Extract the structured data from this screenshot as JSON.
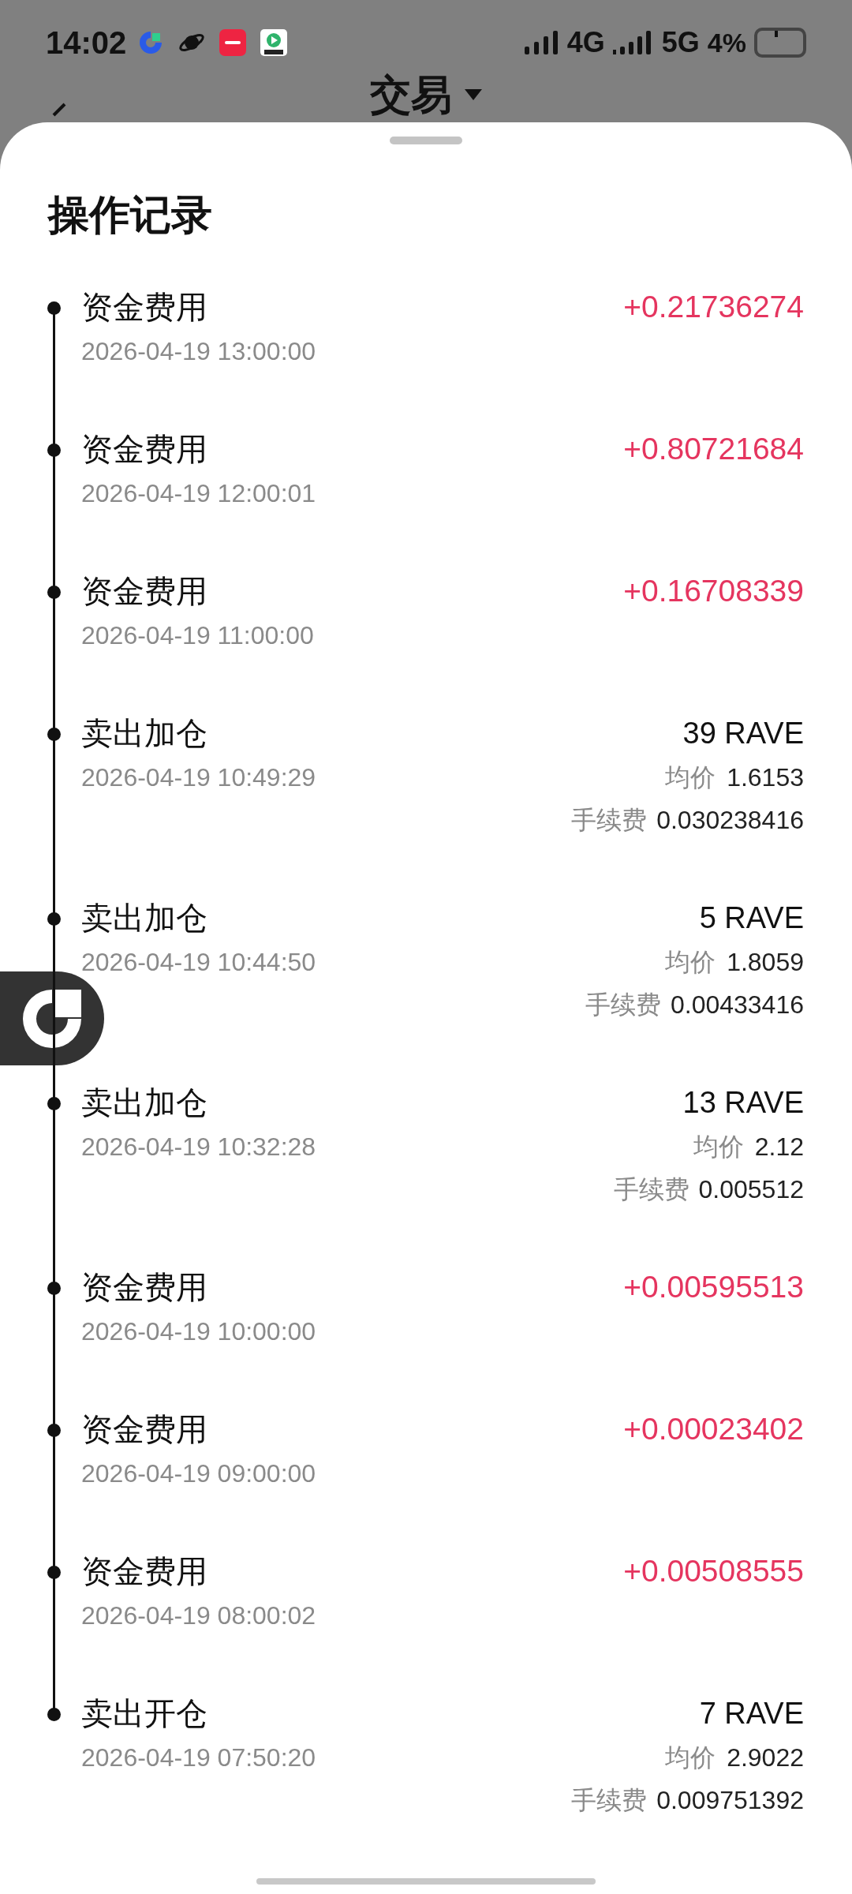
{
  "status_bar": {
    "time": "14:02",
    "network_1": "4G",
    "network_2": "5G",
    "battery": "4%"
  },
  "header": {
    "title": "交易"
  },
  "sheet": {
    "title": "操作记录"
  },
  "records": [
    {
      "kind": "funding",
      "title": "资金费用",
      "time": "2026-04-19 13:00:00",
      "amount": "+0.21736274"
    },
    {
      "kind": "funding",
      "title": "资金费用",
      "time": "2026-04-19 12:00:01",
      "amount": "+0.80721684"
    },
    {
      "kind": "funding",
      "title": "资金费用",
      "time": "2026-04-19 11:00:00",
      "amount": "+0.16708339"
    },
    {
      "kind": "trade",
      "title": "卖出加仓",
      "time": "2026-04-19 10:49:29",
      "quantity": "39 RAVE",
      "avg_price_label": "均价",
      "avg_price": "1.6153",
      "fee_label": "手续费",
      "fee": "0.030238416"
    },
    {
      "kind": "trade",
      "title": "卖出加仓",
      "time": "2026-04-19 10:44:50",
      "quantity": "5 RAVE",
      "avg_price_label": "均价",
      "avg_price": "1.8059",
      "fee_label": "手续费",
      "fee": "0.00433416"
    },
    {
      "kind": "trade",
      "title": "卖出加仓",
      "time": "2026-04-19 10:32:28",
      "quantity": "13 RAVE",
      "avg_price_label": "均价",
      "avg_price": "2.12",
      "fee_label": "手续费",
      "fee": "0.005512"
    },
    {
      "kind": "funding",
      "title": "资金费用",
      "time": "2026-04-19 10:00:00",
      "amount": "+0.00595513"
    },
    {
      "kind": "funding",
      "title": "资金费用",
      "time": "2026-04-19 09:00:00",
      "amount": "+0.00023402"
    },
    {
      "kind": "funding",
      "title": "资金费用",
      "time": "2026-04-19 08:00:02",
      "amount": "+0.00508555"
    },
    {
      "kind": "trade",
      "title": "卖出开仓",
      "time": "2026-04-19 07:50:20",
      "quantity": "7 RAVE",
      "avg_price_label": "均价",
      "avg_price": "2.9022",
      "fee_label": "手续费",
      "fee": "0.009751392"
    }
  ]
}
